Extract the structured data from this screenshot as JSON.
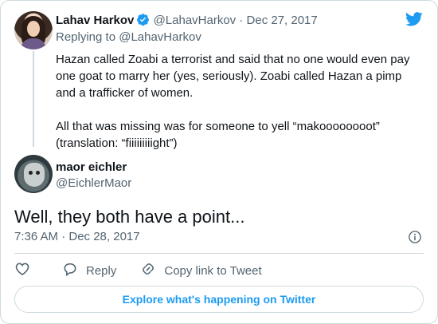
{
  "parent_tweet": {
    "author_name": "Lahav Harkov",
    "handle": "@LahavHarkov",
    "separator": " · ",
    "date": "Dec 27, 2017",
    "replying_to": "Replying to @LahavHarkov",
    "paragraphs": [
      "Hazan called Zoabi a terrorist and said that no one would even pay one goat to marry her (yes, seriously). Zoabi called Hazan a pimp and a trafficker of women.",
      "All that was missing was for someone to yell “makoooooooot” (translation: “fiiiiiiiiight”)"
    ],
    "verified": true
  },
  "main_tweet": {
    "author_name": "maor eichler",
    "handle": "@EichlerMaor",
    "text": "Well, they both have a point...",
    "timestamp": "7:36 AM · Dec 28, 2017"
  },
  "actions": {
    "like_icon": "heart-icon",
    "reply_label": "Reply",
    "copy_link_label": "Copy link to Tweet"
  },
  "explore_label": "Explore what's happening on Twitter",
  "colors": {
    "accent": "#1d9bf0",
    "secondary_text": "#536471",
    "border": "#cfd9de"
  }
}
